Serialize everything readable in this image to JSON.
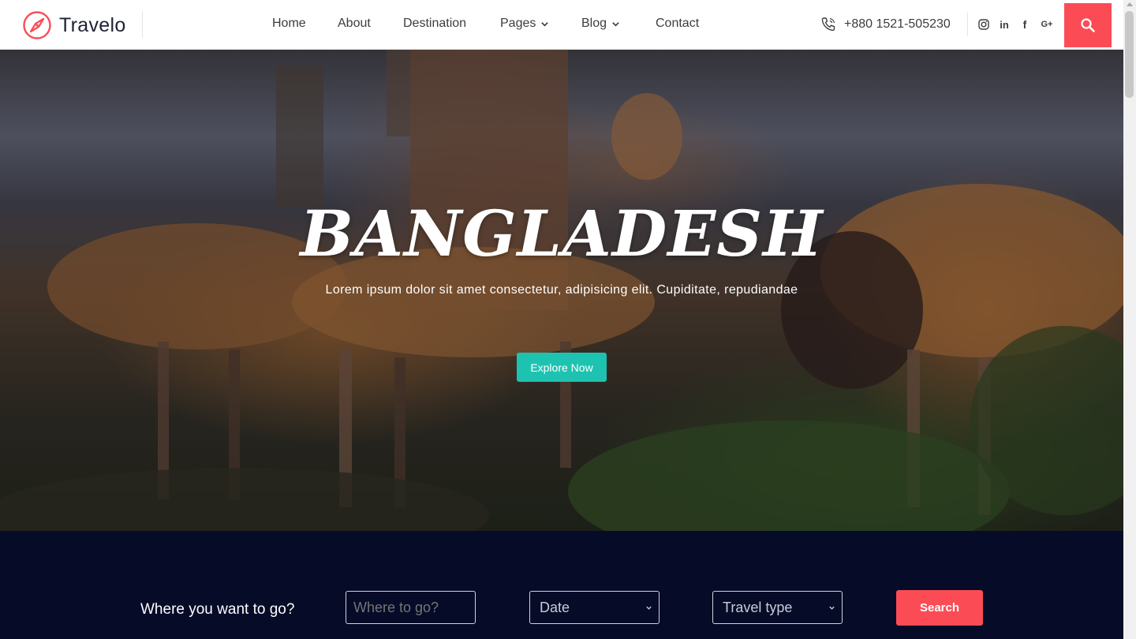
{
  "brand": {
    "name": "Travelo",
    "accent": "#fb4c55",
    "teal": "#1ec2b0",
    "navy": "#060b28"
  },
  "nav": [
    {
      "label": "Home"
    },
    {
      "label": "About"
    },
    {
      "label": "Destination"
    },
    {
      "label": "Pages",
      "dropdown": true
    },
    {
      "label": "Blog",
      "dropdown": true
    },
    {
      "label": "Contact"
    }
  ],
  "contact": {
    "phone": "+880 1521-505230"
  },
  "social": [
    "instagram-icon",
    "linkedin-icon",
    "facebook-icon",
    "google-plus-icon"
  ],
  "hero": {
    "title": "BANGLADESH",
    "subtitle": "Lorem ipsum dolor sit amet consectetur, adipisicing elit. Cupiditate, repudiandae",
    "cta": "Explore Now"
  },
  "search": {
    "label": "Where you want to go?",
    "destination_placeholder": "Where to go?",
    "date_value": "Date",
    "travel_type_value": "Travel type",
    "button": "Search"
  }
}
